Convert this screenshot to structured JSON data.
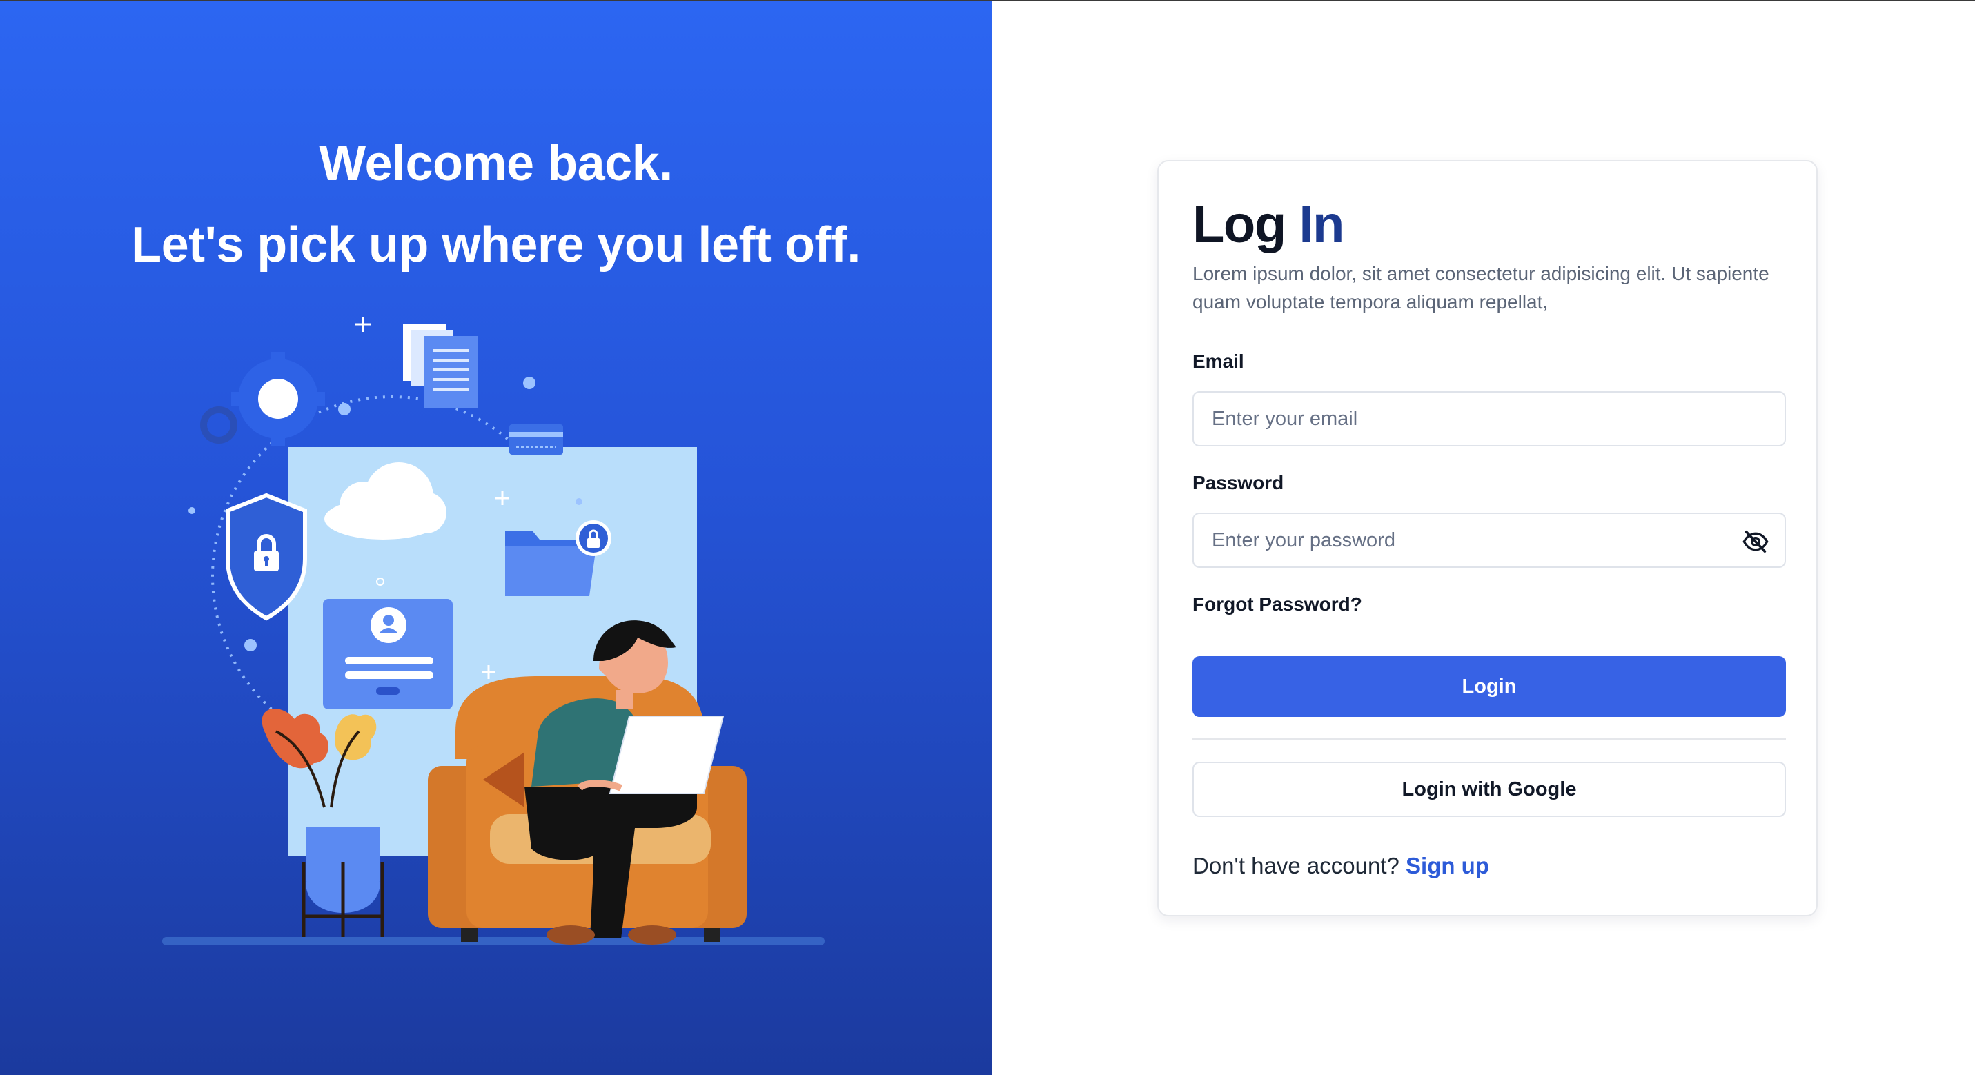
{
  "hero": {
    "line1": "Welcome back.",
    "line2": "Let's pick up where you left off."
  },
  "login": {
    "title_part1": "Log",
    "title_part2": "In",
    "subtitle": "Lorem ipsum dolor, sit amet consectetur adipisicing elit. Ut sapiente quam voluptate tempora aliquam repellat,",
    "email_label": "Email",
    "email_placeholder": "Enter your email",
    "password_label": "Password",
    "password_placeholder": "Enter your password",
    "forgot_label": "Forgot Password?",
    "login_button": "Login",
    "google_button": "Login with Google",
    "no_account_text": "Don't have account?",
    "signup_link": "Sign up"
  },
  "colors": {
    "panel_gradient_top": "#2c66f2",
    "panel_gradient_bottom": "#1b3a9e",
    "primary_button": "#3762e5",
    "link": "#2d5bd8",
    "title_accent": "#1c3a8f"
  },
  "icons": {
    "password_toggle": "eye-slash-icon",
    "illustration": "person-on-armchair-with-laptop-security-illustration"
  }
}
